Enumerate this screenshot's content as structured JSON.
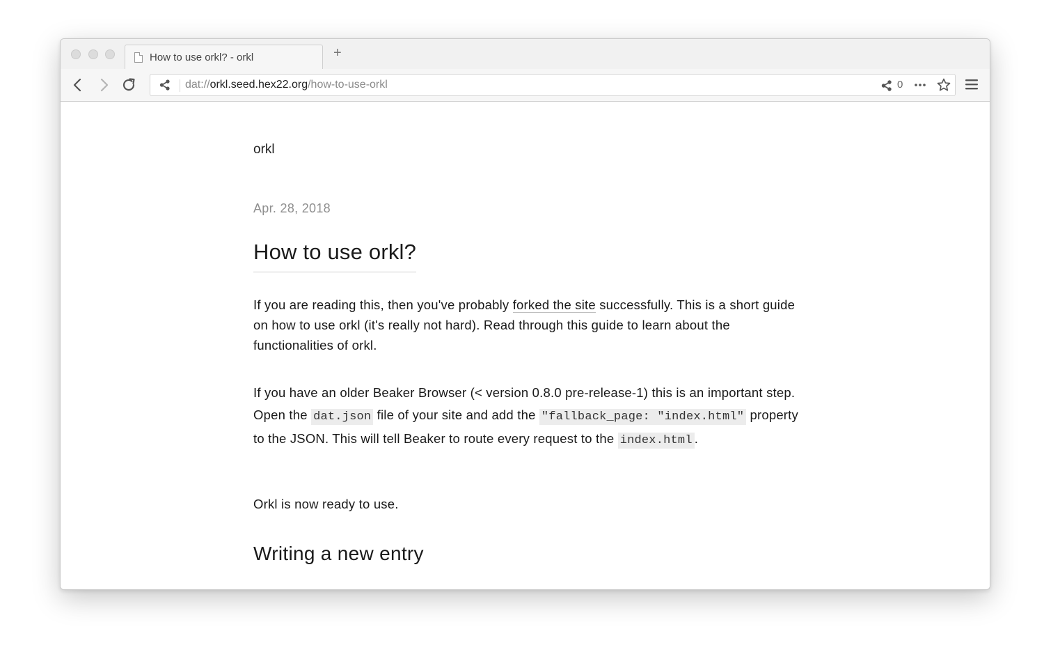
{
  "browser": {
    "tab_title": "How to use orkl? - orkl",
    "new_tab_label": "+",
    "url": {
      "scheme": "dat://",
      "host": "orkl.seed.hex22.org",
      "path": "/how-to-use-orkl"
    },
    "peer_count": "0",
    "icons": [
      "close-dot",
      "minimize-dot",
      "zoom-dot",
      "page-icon",
      "back-arrow-icon",
      "forward-arrow-icon",
      "reload-icon",
      "share-icon",
      "more-icon",
      "star-icon",
      "menu-icon"
    ]
  },
  "page": {
    "site_name": "orkl",
    "date": "Apr. 28, 2018",
    "title": "How to use orkl?",
    "p1": {
      "before_link": "If you are reading this, then you've probably ",
      "link": "forked the site",
      "after_link": " successfully. This is a short guide on how to use orkl (it's really not hard). Read through this guide to learn about the functionalities of orkl."
    },
    "p2": {
      "t1": "If you have an older Beaker Browser (< version 0.8.0 pre-release-1) this is an important step. Open the ",
      "c1": "dat.json",
      "t2": " file of your site and add the ",
      "c2": "\"fallback_page: \"index.html\"",
      "t3": " property to the JSON. This will tell Beaker to route every request to the ",
      "c3": "index.html",
      "t4": "."
    },
    "p3": "Orkl is now ready to use.",
    "section_title": "Writing a new entry"
  }
}
